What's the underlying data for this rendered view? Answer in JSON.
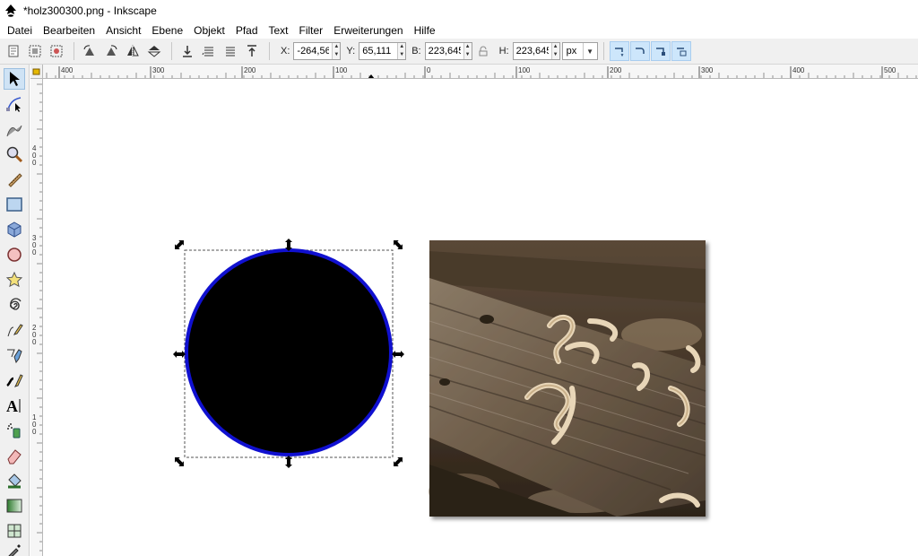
{
  "window": {
    "title": "*holz300300.png - Inkscape",
    "app_icon": "inkscape-logo-icon"
  },
  "menu": [
    {
      "label": "Datei",
      "name": "menu-datei"
    },
    {
      "label": "Bearbeiten",
      "name": "menu-bearbeiten"
    },
    {
      "label": "Ansicht",
      "name": "menu-ansicht"
    },
    {
      "label": "Ebene",
      "name": "menu-ebene"
    },
    {
      "label": "Objekt",
      "name": "menu-objekt"
    },
    {
      "label": "Pfad",
      "name": "menu-pfad"
    },
    {
      "label": "Text",
      "name": "menu-text"
    },
    {
      "label": "Filter",
      "name": "menu-filter"
    },
    {
      "label": "Erweiterungen",
      "name": "menu-erweiterungen"
    },
    {
      "label": "Hilfe",
      "name": "menu-hilfe"
    }
  ],
  "tool_controls": {
    "x": {
      "label": "X:",
      "value": "-264,56"
    },
    "y": {
      "label": "Y:",
      "value": "65,111"
    },
    "w": {
      "label": "B:",
      "value": "223,645"
    },
    "h": {
      "label": "H:",
      "value": "223,645"
    },
    "unit": "px"
  },
  "rulers": {
    "top_ticks": [
      "400",
      "300",
      "200",
      "100",
      "0",
      "100",
      "200",
      "300",
      "400",
      "500"
    ],
    "left_ticks": [
      "4",
      "3",
      "2",
      "1"
    ]
  },
  "canvas": {
    "circle": {
      "fill": "#000000",
      "stroke": "#1010d0"
    },
    "photo": {
      "subject": "wood plank with shavings"
    }
  },
  "colors": {
    "selection_blue": "#cde6fb",
    "toolbar_bg": "#f0f0f0"
  }
}
